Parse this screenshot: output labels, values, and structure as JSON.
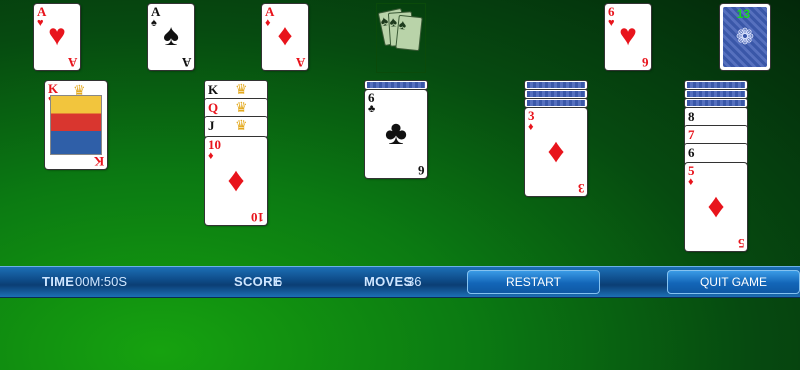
{
  "foundations": [
    {
      "rank": "A",
      "suit": "♥",
      "color": "red"
    },
    {
      "rank": "A",
      "suit": "♠",
      "color": "black"
    },
    {
      "rank": "A",
      "suit": "♦",
      "color": "red"
    }
  ],
  "waste_top": {
    "rank": "6",
    "suit": "♥",
    "color": "red"
  },
  "stock": {
    "count": "13"
  },
  "waste_fan_suit": "♠",
  "tableau": {
    "col1": {
      "rank": "K",
      "suit": "♥"
    },
    "col2": {
      "strips": [
        {
          "rank": "K",
          "suit": "♠"
        },
        {
          "rank": "Q",
          "suit": "♥"
        },
        {
          "rank": "J",
          "suit": "♠"
        }
      ],
      "top": {
        "rank": "10",
        "suit": "♦"
      }
    },
    "col3": {
      "top": {
        "rank": "6",
        "suit": "♣"
      }
    },
    "col4": {
      "top": {
        "rank": "3",
        "suit": "♦"
      }
    },
    "col5": {
      "strips": [
        {
          "rank": "8",
          "suit": ""
        },
        {
          "rank": "7",
          "suit": ""
        },
        {
          "rank": "6",
          "suit": ""
        }
      ],
      "top": {
        "rank": "5",
        "suit": "♦"
      }
    }
  },
  "status": {
    "time_label": "TIME",
    "time_value": "00M:50S",
    "score_label": "SCORE",
    "score_value": "6",
    "moves_label": "MOVES",
    "moves_value": "36",
    "restart_label": "RESTART",
    "quit_label": "QUIT GAME"
  }
}
